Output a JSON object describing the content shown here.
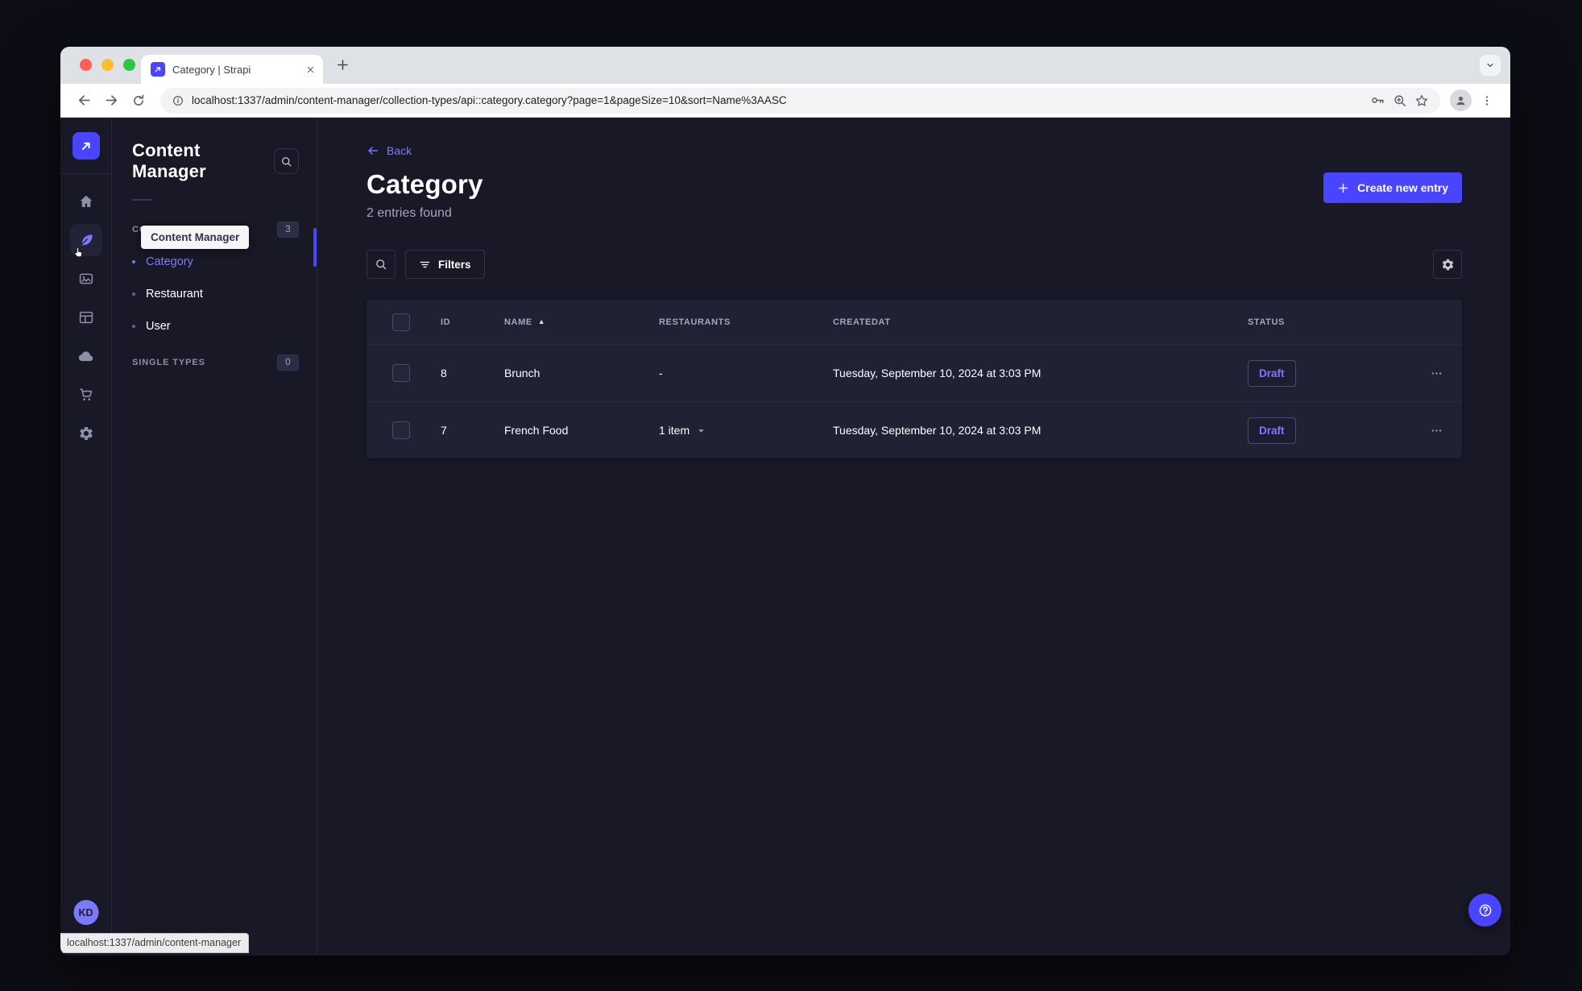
{
  "colors": {
    "accent": "#4945ff",
    "accent_light": "#7b79ff",
    "app_background": "#181826",
    "panel_background": "#212134",
    "border": "#32324d",
    "traffic_red": "#ff5f57",
    "traffic_yellow": "#febc2e",
    "traffic_green": "#28c840"
  },
  "browser": {
    "tab": {
      "title": "Category | Strapi",
      "favicon": "strapi-logo-icon"
    },
    "address": {
      "url": "localhost:1337/admin/content-manager/collection-types/api::category.category?page=1&pageSize=10&sort=Name%3AASC"
    },
    "toolbar_icons": [
      "back-icon",
      "forward-icon",
      "reload-icon",
      "info-icon",
      "key-icon",
      "zoom-icon",
      "star-icon",
      "profile-icon",
      "menu-icon"
    ],
    "status_bar_link": "localhost:1337/admin/content-manager"
  },
  "nav": {
    "tooltip": "Content Manager",
    "items": [
      {
        "icon": "home-icon"
      },
      {
        "icon": "content-manager-icon",
        "active": true
      },
      {
        "icon": "media-library-icon"
      },
      {
        "icon": "content-type-builder-icon"
      },
      {
        "icon": "cloud-icon"
      },
      {
        "icon": "marketplace-icon"
      },
      {
        "icon": "settings-icon"
      }
    ],
    "user_initials": "KD"
  },
  "subnav": {
    "title": "Content Manager",
    "collection_types": {
      "label": "COLLECTION TYPES",
      "count": "3",
      "items": [
        {
          "label": "Category",
          "active": true
        },
        {
          "label": "Restaurant",
          "active": false
        },
        {
          "label": "User",
          "active": false
        }
      ]
    },
    "single_types": {
      "label": "SINGLE TYPES",
      "count": "0"
    }
  },
  "main": {
    "back_label": "Back",
    "title": "Category",
    "subtitle": "2 entries found",
    "create_button_label": "Create new entry",
    "filters_button_label": "Filters",
    "table": {
      "columns": [
        "ID",
        "NAME",
        "RESTAURANTS",
        "CREATEDAT",
        "STATUS"
      ],
      "sorted_column": "NAME",
      "sort_direction": "ASC",
      "rows": [
        {
          "id": "8",
          "name": "Brunch",
          "restaurants": "-",
          "created_at": "Tuesday, September 10, 2024 at 3:03 PM",
          "status": "Draft"
        },
        {
          "id": "7",
          "name": "French Food",
          "restaurants": "1 item",
          "created_at": "Tuesday, September 10, 2024 at 3:03 PM",
          "status": "Draft"
        }
      ]
    }
  }
}
